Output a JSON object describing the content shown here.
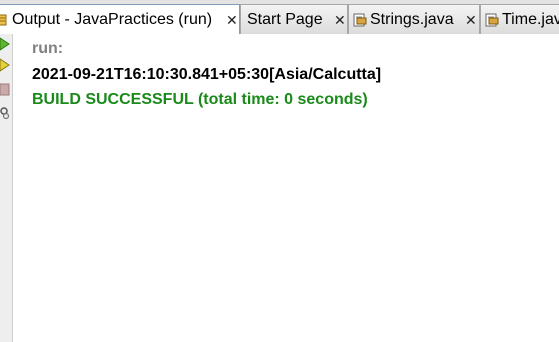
{
  "tabs": [
    {
      "label": "Output - JavaPractices (run)",
      "active": true,
      "icon": "output-icon",
      "closable": true
    },
    {
      "label": "Start Page",
      "active": false,
      "icon": "",
      "closable": true
    },
    {
      "label": "Strings.java",
      "active": false,
      "icon": "java-file-icon",
      "closable": true
    },
    {
      "label": "Time.jav",
      "active": false,
      "icon": "java-file-icon",
      "closable": false
    }
  ],
  "close_glyph": "✕",
  "gutter": {
    "buttons": [
      "rerun-icon",
      "rerun-with-arguments-icon",
      "stop-icon",
      "settings-icon"
    ]
  },
  "output": {
    "run_line": "run:",
    "program_output": "2021-09-21T16:10:30.841+05:30[Asia/Calcutta]",
    "build_status": "BUILD SUCCESSFUL (total time: 0 seconds)"
  },
  "colors": {
    "run_text": "#808080",
    "output_text": "#000000",
    "success_text": "#1a8a1a",
    "tab_bar_bg": "#e3e3e3"
  }
}
